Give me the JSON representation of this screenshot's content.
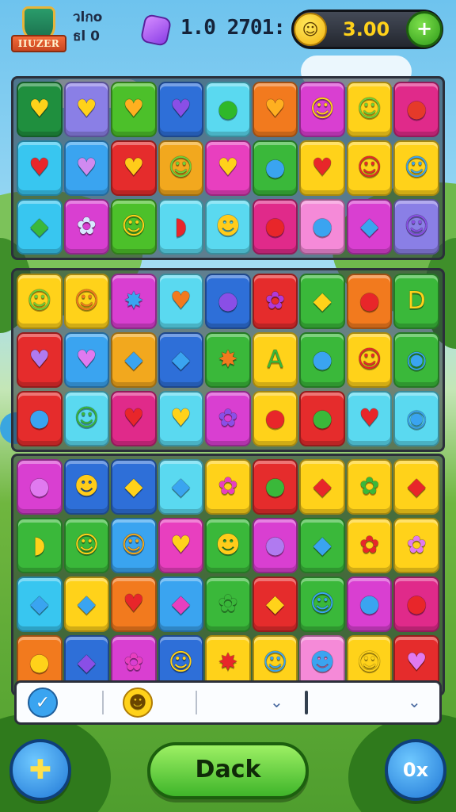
{
  "header": {
    "crest_label": "IIUZER",
    "level_line1": "วlกo",
    "level_line2": "ธl 0",
    "score": "1.0 2701:",
    "coins": "3.00",
    "add_label": "+"
  },
  "boards": [
    {
      "rows": [
        [
          [
            "#1f8f3e",
            "#ffd21a",
            "♥"
          ],
          [
            "#8a7fe6",
            "#ffd21a",
            "♥"
          ],
          [
            "#4cc02a",
            "#ffb020",
            "♥"
          ],
          [
            "#2e6fd8",
            "#8a4fe6",
            "♥"
          ],
          [
            "#5ad9f0",
            "#2fb82a",
            "●"
          ],
          [
            "#f27a1e",
            "#ffb020",
            "♥"
          ],
          [
            "#d93fd1",
            "#ffd21a",
            "☺"
          ],
          [
            "#ffd21a",
            "#6fd23a",
            "☺"
          ],
          [
            "#e02a8a",
            "#e53a2a",
            "●"
          ]
        ],
        [
          [
            "#38c6f0",
            "#e8262a",
            "♥"
          ],
          [
            "#3aa4f0",
            "#d08af0",
            "♥"
          ],
          [
            "#e52c2c",
            "#ffcc1a",
            "♥"
          ],
          [
            "#f2a81e",
            "#6fd23a",
            "☺"
          ],
          [
            "#e83fbf",
            "#ffd21a",
            "♥"
          ],
          [
            "#3ab83a",
            "#3aa4f0",
            "●"
          ],
          [
            "#ffd21a",
            "#e8262a",
            "♥"
          ],
          [
            "#ffd21a",
            "#e8262a",
            "☺"
          ],
          [
            "#ffd21a",
            "#3aa4f0",
            "☺"
          ]
        ],
        [
          [
            "#38c6f0",
            "#3ab83a",
            "◆"
          ],
          [
            "#d93fd1",
            "#d8e8ff",
            "✿"
          ],
          [
            "#4cc02a",
            "#ffd21a",
            "☺"
          ],
          [
            "#5ad9f0",
            "#e8262a",
            "◗"
          ],
          [
            "#5ad9f0",
            "#ffcc1a",
            "☻"
          ],
          [
            "#e02a8a",
            "#e8262a",
            "●"
          ],
          [
            "#f58ad8",
            "#3aa4f0",
            "●"
          ],
          [
            "#d93fd1",
            "#3aa4f0",
            "◆"
          ],
          [
            "#8a7fe6",
            "#8a4fe6",
            "☺"
          ]
        ]
      ]
    },
    {
      "rows": [
        [
          [
            "#ffd21a",
            "#6fd23a",
            "☺"
          ],
          [
            "#ffd21a",
            "#f27a1e",
            "☺"
          ],
          [
            "#d93fd1",
            "#3aa4f0",
            "✸"
          ],
          [
            "#5ad9f0",
            "#f27a1e",
            "♥"
          ],
          [
            "#2e6fd8",
            "#8a4fe6",
            "●"
          ],
          [
            "#e52c2c",
            "#b03ad8",
            "✿"
          ],
          [
            "#3ab83a",
            "#ffd21a",
            "◆"
          ],
          [
            "#f27a1e",
            "#e8262a",
            "●"
          ],
          [
            "#3ab83a",
            "#ffd21a",
            "D"
          ]
        ],
        [
          [
            "#e52c2c",
            "#b07af0",
            "♥"
          ],
          [
            "#3aa4f0",
            "#e07af0",
            "♥"
          ],
          [
            "#f2a81e",
            "#3aa4f0",
            "◆"
          ],
          [
            "#2e6fd8",
            "#3aa4f0",
            "◆"
          ],
          [
            "#3ab83a",
            "#f27a1e",
            "✸"
          ],
          [
            "#ffd21a",
            "#3ab83a",
            "A"
          ],
          [
            "#3ab83a",
            "#3aa4f0",
            "●"
          ],
          [
            "#ffd21a",
            "#e8262a",
            "☺"
          ],
          [
            "#3ab83a",
            "#3aa4f0",
            "◉"
          ]
        ],
        [
          [
            "#e52c2c",
            "#3aa4f0",
            "●"
          ],
          [
            "#5ad9f0",
            "#3ab83a",
            "☺"
          ],
          [
            "#e02a8a",
            "#e8262a",
            "♥"
          ],
          [
            "#5ad9f0",
            "#ffd21a",
            "♥"
          ],
          [
            "#d93fd1",
            "#8a4fe6",
            "✿"
          ],
          [
            "#ffd21a",
            "#e8262a",
            "●"
          ],
          [
            "#e52c2c",
            "#3ab83a",
            "●"
          ],
          [
            "#5ad9f0",
            "#e8262a",
            "♥"
          ],
          [
            "#5ad9f0",
            "#3aa4f0",
            "◉"
          ]
        ]
      ]
    },
    {
      "rows": [
        [
          [
            "#d93fd1",
            "#e07af0",
            "●"
          ],
          [
            "#2e6fd8",
            "#ffcc1a",
            "☻"
          ],
          [
            "#2e6fd8",
            "#ffd21a",
            "◆"
          ],
          [
            "#5ad9f0",
            "#3aa4f0",
            "◆"
          ],
          [
            "#ffd21a",
            "#e83fbf",
            "✿"
          ],
          [
            "#e52c2c",
            "#3ab83a",
            "●"
          ],
          [
            "#ffd21a",
            "#e8262a",
            "◆"
          ],
          [
            "#ffd21a",
            "#3ab83a",
            "✿"
          ],
          [
            "#ffd21a",
            "#e8262a",
            "◆"
          ]
        ],
        [
          [
            "#3ab83a",
            "#ffd21a",
            "◗"
          ],
          [
            "#3ab83a",
            "#ffd21a",
            "☺"
          ],
          [
            "#3aa4f0",
            "#f2a81e",
            "☺"
          ],
          [
            "#e83fbf",
            "#ffd21a",
            "♥"
          ],
          [
            "#3ab83a",
            "#ffcc1a",
            "☻"
          ],
          [
            "#d93fd1",
            "#b07af0",
            "●"
          ],
          [
            "#3ab83a",
            "#3aa4f0",
            "◆"
          ],
          [
            "#ffd21a",
            "#e8262a",
            "✿"
          ],
          [
            "#ffd21a",
            "#e07af0",
            "✿"
          ]
        ],
        [
          [
            "#38c6f0",
            "#3aa4f0",
            "◆"
          ],
          [
            "#ffd21a",
            "#3aa4f0",
            "◆"
          ],
          [
            "#f27a1e",
            "#e8262a",
            "♥"
          ],
          [
            "#3aa4f0",
            "#e83fbf",
            "◆"
          ],
          [
            "#3ab83a",
            "#3ab83a",
            "✿"
          ],
          [
            "#e52c2c",
            "#ffd21a",
            "◆"
          ],
          [
            "#3ab83a",
            "#3aa4f0",
            "☺"
          ],
          [
            "#d93fd1",
            "#3aa4f0",
            "●"
          ],
          [
            "#e02a8a",
            "#e8262a",
            "●"
          ]
        ],
        [
          [
            "#f27a1e",
            "#ffd21a",
            "●"
          ],
          [
            "#2e6fd8",
            "#8a4fe6",
            "◆"
          ],
          [
            "#d93fd1",
            "#e83fbf",
            "✿"
          ],
          [
            "#2e6fd8",
            "#ffd21a",
            "☺"
          ],
          [
            "#ffd21a",
            "#e8262a",
            "✸"
          ],
          [
            "#ffd21a",
            "#3aa4f0",
            "☺"
          ],
          [
            "#f58ad8",
            "#3aa4f0",
            "☻"
          ],
          [
            "#ffd21a",
            "#ffd21a",
            "☺"
          ],
          [
            "#e52c2c",
            "#e07af0",
            "♥"
          ]
        ]
      ]
    }
  ],
  "tray": {
    "slot1_icon": "✓",
    "slot2_icon": "☻",
    "chevron1": "⌄",
    "chevron2": "⌄"
  },
  "buttons": {
    "left_icon": "✚",
    "back_label": "Dack",
    "right_label": "0x"
  },
  "icons": {
    "left_round_button": "plus-arrow-icon",
    "gem": "gem-icon",
    "coin": "coin-icon"
  }
}
